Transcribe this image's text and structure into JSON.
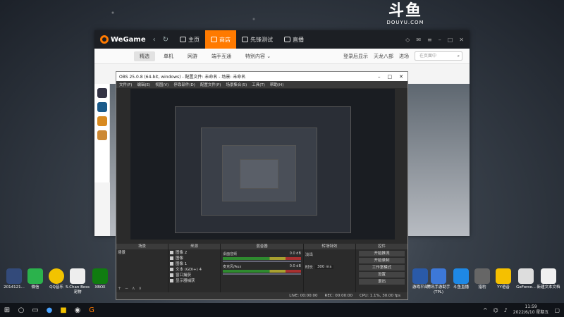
{
  "douyu": {
    "logo": "斗鱼",
    "domain": "DOUYU.COM"
  },
  "wegame": {
    "logo": "WeGame",
    "tabs": [
      {
        "label": "主页"
      },
      {
        "label": "商店"
      },
      {
        "label": "先锋测试"
      },
      {
        "label": "直播"
      }
    ],
    "subtabs": [
      "精选",
      "单机",
      "网游",
      "端手互通",
      "特别内容"
    ],
    "sub_right": [
      "登录后显示",
      "天龙八部",
      "进场"
    ],
    "search_placeholder": "在页面中"
  },
  "obs": {
    "title": "OBS 25.0.8 (64-bit, windows) - 配置文件: 未命名 - 场景: 未命名",
    "menu": [
      "文件(F)",
      "编辑(E)",
      "视图(V)",
      "停靠部件(D)",
      "配置文件(P)",
      "场景集合(S)",
      "工具(T)",
      "帮助(H)"
    ],
    "docks": {
      "scenes": {
        "header": "场景",
        "items": [
          "场景"
        ]
      },
      "sources": {
        "header": "来源",
        "items": [
          "图像 2",
          "图像",
          "图像 1",
          "文本 (GDI+) 4",
          "窗口捕获",
          "显示器捕获"
        ]
      },
      "mixer": {
        "header": "混音器",
        "rows": [
          {
            "label": "桌面音频",
            "db": "0.0 dB"
          },
          {
            "label": "麦克风/Aux",
            "db": "0.0 dB"
          }
        ]
      },
      "transitions": {
        "header": "转场特效",
        "mode": "淡出",
        "duration_label": "时长",
        "duration": "300 ms"
      },
      "controls": {
        "header": "控件",
        "buttons": [
          "开始推流",
          "开始录制",
          "工作室模式",
          "设置",
          "退出"
        ]
      }
    },
    "status": [
      "LIVE: 00:00:00",
      "REC: 00:00:00",
      "CPU: 1.1%, 30.00 fps"
    ]
  },
  "desktop_icons": [
    "2014121...",
    "微信",
    "QQ音乐",
    "5.Chan\nBoss宠物",
    "XBOX",
    "游戏平台",
    "腾讯手游助手\n(TPL)",
    "斗鱼直播",
    "猎豹",
    "YY语音",
    "GeForce...",
    "新建文本文档"
  ],
  "taskbar": {
    "time": "11:59",
    "date": "2022/6/10 星期五"
  },
  "colors": {
    "wegame_accent": "#ff7a00",
    "obs_bg": "#2b2b2b",
    "taskbar": "#101318"
  }
}
